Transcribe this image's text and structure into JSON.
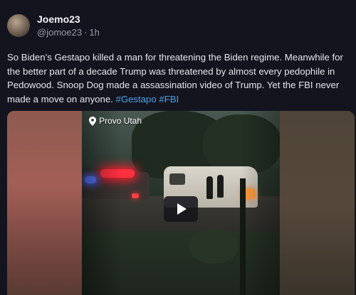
{
  "post": {
    "author": {
      "display_name": "Joemo23",
      "handle": "@jomoe23",
      "separator": "·",
      "time": "1h"
    },
    "text_part1": "So Biden’s Gestapo killed a man for threatening the Biden regime. Meanwhile for the better part of a decade Trump was threatened by almost every pedophile in Pedowood. Snoop Dog made a assassination video of Trump. Yet the FBI never made a move on anyone.",
    "hashtags": [
      "#Gestapo",
      "#FBI"
    ],
    "media": {
      "location_label": "Provo Utah",
      "location_icon": "map-pin-icon",
      "play_icon": "play-icon"
    }
  },
  "colors": {
    "background": "#14141f",
    "hashtag": "#4aa3e8",
    "muted_text": "#9a9aab"
  }
}
